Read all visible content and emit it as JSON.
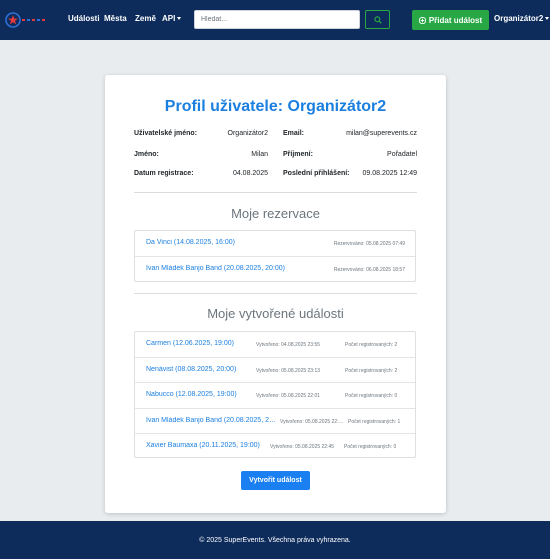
{
  "nav": {
    "links": [
      "Události",
      "Města",
      "Země",
      "API"
    ],
    "search_placeholder": "Hledat...",
    "add_event": "Přidat událost",
    "user": "Organizátor2",
    "colors": {
      "navbar": "#0d2c5c",
      "success": "#28a745",
      "primary": "#1b7fe0"
    }
  },
  "profile": {
    "title": "Profil uživatele: Organizátor2",
    "username_label": "Uživatelské jméno:",
    "username": "Organizátor2",
    "email_label": "Email:",
    "email": "milan@superevents.cz",
    "first_name_label": "Jméno:",
    "first_name": "Milan",
    "last_name_label": "Příjmení:",
    "last_name": "Pořadatel",
    "registered_label": "Datum registrace:",
    "registered": "04.08.2025",
    "last_login_label": "Poslední přihlášení:",
    "last_login": "09.08.2025 12:49"
  },
  "reservations": {
    "title": "Moje rezervace",
    "items": [
      {
        "event": "Da Vinci (14.08.2025, 16:00)",
        "reserved": "Rezervováno: 05.08.2025 07:49"
      },
      {
        "event": "Ivan Mládek Banjo Band (20.08.2025, 20:00)",
        "reserved": "Rezervováno: 06.08.2025 18:57"
      }
    ]
  },
  "created_events": {
    "title": "Moje vytvořené události",
    "items": [
      {
        "event": "Carmen (12.06.2025, 19:00)",
        "created": "Vytvořeno: 04.08.2025 23:55",
        "registered": "Počet registrovaných: 2"
      },
      {
        "event": "Nenávist (08.08.2025, 20:00)",
        "created": "Vytvořeno: 05.08.2025 23:13",
        "registered": "Počet registrovaných: 2"
      },
      {
        "event": "Nabucco (12.08.2025, 19:00)",
        "created": "Vytvořeno: 05.08.2025 22:01",
        "registered": "Počet registrovaných: 0"
      },
      {
        "event": "Ivan Mládek Banjo Band (20.08.2025, 20:00)",
        "created": "Vytvořeno: 05.08.2025 22:37",
        "registered": "Počet registrovaných: 1"
      },
      {
        "event": "Xavier Baumaxa (20.11.2025, 19:00)",
        "created": "Vytvořeno: 05.08.2025 22:45",
        "registered": "Počet registrovaných: 0"
      }
    ],
    "create_button": "Vytvořit událost"
  },
  "footer": {
    "text": "© 2025 SuperEvents. Všechna práva vyhrazena."
  }
}
